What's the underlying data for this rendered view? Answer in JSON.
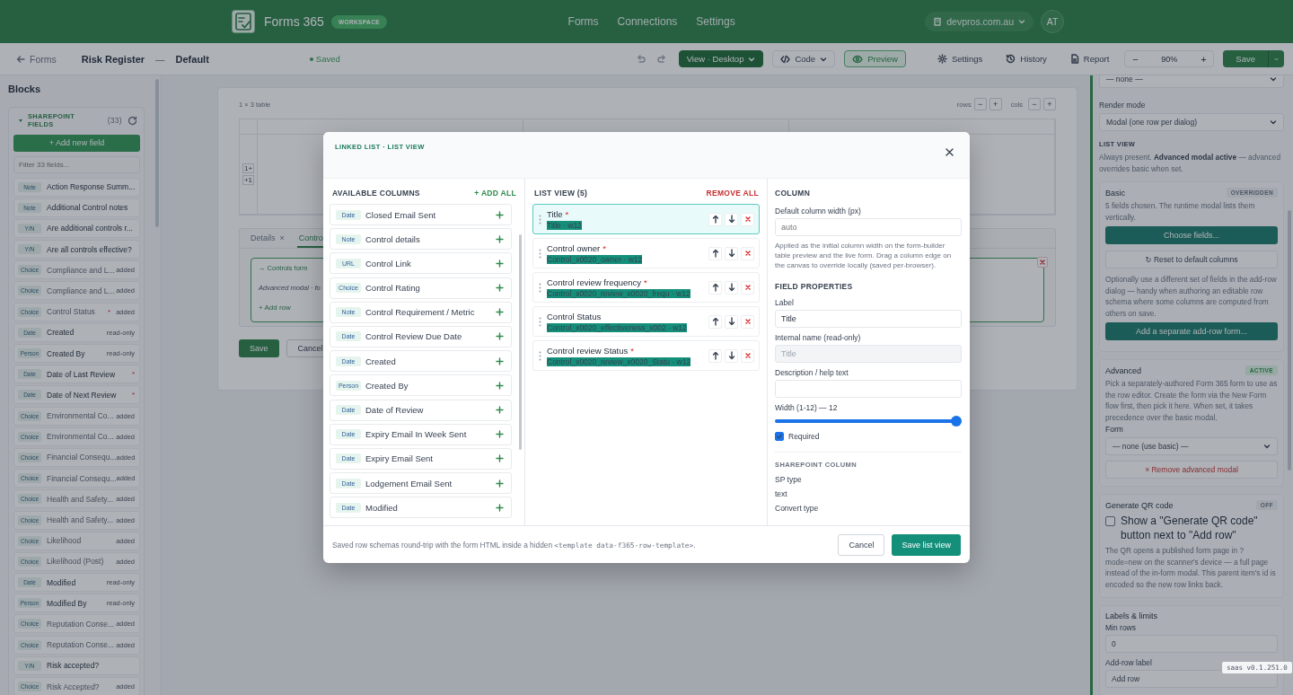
{
  "topbar": {
    "brand": "Forms 365",
    "badge": "WORKSPACE",
    "nav": [
      "Forms",
      "Connections",
      "Settings"
    ],
    "tenant": "devpros.com.au",
    "avatar": "AT"
  },
  "toolbar": {
    "back": "Forms",
    "title": "Risk Register",
    "separator": "—",
    "view_name": "Default",
    "status": "Saved",
    "view_button": "View · Desktop",
    "code_button": "Code",
    "preview_button": "Preview",
    "settings_button": "Settings",
    "history_button": "History",
    "report_button": "Report",
    "zoom_out": "−",
    "zoom": "90%",
    "zoom_in": "+",
    "save_button": "Save"
  },
  "sidebar": {
    "title": "Blocks",
    "section": "SHAREPOINT FIELDS",
    "count": "(33)",
    "add_button": "+ Add new field",
    "filter_placeholder": "Filter 33 fields...",
    "fields": [
      {
        "type": "Note",
        "name": "Action Response Summ...",
        "added": false
      },
      {
        "type": "Note",
        "name": "Additional Control notes",
        "added": false
      },
      {
        "type": "Y/N",
        "name": "Are additional controls r...",
        "added": false
      },
      {
        "type": "Y/N",
        "name": "Are all controls effective?",
        "added": false
      },
      {
        "type": "Choice",
        "name": "Compliance and L...",
        "tag": "added",
        "added": true
      },
      {
        "type": "Choice",
        "name": "Compliance and L...",
        "tag": "added",
        "added": true
      },
      {
        "type": "Choice",
        "name": "Control Status",
        "required_mark": "*",
        "tag": "added",
        "added": true
      },
      {
        "type": "Date",
        "name": "Created",
        "tag": "read-only",
        "added": false
      },
      {
        "type": "Person",
        "name": "Created By",
        "tag": "read-only",
        "added": false
      },
      {
        "type": "Date",
        "name": "Date of Last Review",
        "required_mark": "*",
        "added": false
      },
      {
        "type": "Date",
        "name": "Date of Next Review",
        "required_mark": "*",
        "added": false
      },
      {
        "type": "Choice",
        "name": "Environmental Co...",
        "tag": "added",
        "added": true
      },
      {
        "type": "Choice",
        "name": "Environmental Co...",
        "tag": "added",
        "added": true
      },
      {
        "type": "Choice",
        "name": "Financial Consequ...",
        "tag": "added",
        "added": true
      },
      {
        "type": "Choice",
        "name": "Financial Consequ...",
        "tag": "added",
        "added": true
      },
      {
        "type": "Choice",
        "name": "Health and Safety...",
        "tag": "added",
        "added": true
      },
      {
        "type": "Choice",
        "name": "Health and Safety...",
        "tag": "added",
        "added": true
      },
      {
        "type": "Choice",
        "name": "Likelihood",
        "tag": "added",
        "added": true
      },
      {
        "type": "Choice",
        "name": "Likelihood (Post)",
        "tag": "added",
        "added": true
      },
      {
        "type": "Date",
        "name": "Modified",
        "tag": "read-only",
        "added": false
      },
      {
        "type": "Person",
        "name": "Modified By",
        "tag": "read-only",
        "added": false
      },
      {
        "type": "Choice",
        "name": "Reputation Conse...",
        "tag": "added",
        "added": true
      },
      {
        "type": "Choice",
        "name": "Reputation Conse...",
        "tag": "added",
        "added": true
      },
      {
        "type": "Y/N",
        "name": "Risk accepted?",
        "added": false
      },
      {
        "type": "Choice",
        "name": "Risk Accepted?",
        "tag": "added",
        "added": true
      }
    ]
  },
  "canvas": {
    "table_label": "1 × 3 table",
    "rows_label": "rows",
    "rows_minus": "−",
    "rows_plus": "+",
    "cols_label": "cols",
    "cols_minus": "−",
    "cols_plus": "+",
    "row_handles": [
      "1+",
      "+1"
    ],
    "tabs": [
      {
        "label": "Details",
        "close": "×",
        "selected": false
      },
      {
        "label": "Contro",
        "selected": true
      }
    ],
    "linked_form": "→ Controls form",
    "linked_note": "Advanced modal · fo",
    "add_row": "+ Add row",
    "save_button": "Save",
    "cancel_button": "Cancel"
  },
  "properties": {
    "top_select": "— none —",
    "render_label": "Render mode",
    "render_value": "Modal (one row per dialog)",
    "list_view_heading": "LIST VIEW",
    "list_view_note": "Always present. **Advanced modal active** — advanced overrides basic when set.",
    "basic": {
      "title": "Basic",
      "badge": "OVERRIDDEN",
      "badge_active": false,
      "text": "5 fields chosen. The runtime modal lists them vertically.",
      "choose_button": "Choose fields...",
      "reset_button": "↻ Reset to default columns",
      "add_row_text": "Optionally use a different set of fields in the add-row dialog — handy when authoring an editable row schema where some columns are computed from others on save.",
      "add_row_button": "Add a separate add-row form..."
    },
    "advanced": {
      "title": "Advanced",
      "badge": "ACTIVE",
      "badge_active": true,
      "text": "Pick a separately-authored Form 365 form to use as the row editor. Create the form via the New Form flow first, then pick it here. When set, it takes precedence over the basic modal.",
      "form_label": "Form",
      "form_value": "— none (use basic) —",
      "remove_button": "× Remove advanced modal"
    },
    "qr": {
      "title": "Generate QR code",
      "badge": "OFF",
      "checkbox_label": "Show a \"Generate QR code\" button next to \"Add row\"",
      "checked": false,
      "text": "The QR opens a published form page in ?mode=new on the scanner's device — a full page instead of the in-form modal. This parent item's id is encoded so the new row links back."
    },
    "limits": {
      "title": "Labels & limits",
      "min_label": "Min rows",
      "min_value": "0",
      "add_label": "Add-row label",
      "add_value": "Add row"
    }
  },
  "modal": {
    "eyebrow": "LINKED LIST · LIST VIEW",
    "available": {
      "heading": "AVAILABLE COLUMNS",
      "add_all": "+ ADD ALL",
      "items": [
        {
          "type": "Date",
          "name": "Closed Email Sent"
        },
        {
          "type": "Note",
          "name": "Control details"
        },
        {
          "type": "URL",
          "name": "Control Link"
        },
        {
          "type": "Choice",
          "name": "Control Rating"
        },
        {
          "type": "Note",
          "name": "Control Requirement / Metric"
        },
        {
          "type": "Date",
          "name": "Control Review Due Date"
        },
        {
          "type": "Date",
          "name": "Created"
        },
        {
          "type": "Person",
          "name": "Created By"
        },
        {
          "type": "Date",
          "name": "Date of Review"
        },
        {
          "type": "Date",
          "name": "Expiry Email In Week Sent"
        },
        {
          "type": "Date",
          "name": "Expiry Email Sent"
        },
        {
          "type": "Date",
          "name": "Lodgement Email Sent"
        },
        {
          "type": "Date",
          "name": "Modified"
        }
      ]
    },
    "list_view": {
      "heading": "LIST VIEW (5)",
      "remove_all": "REMOVE ALL",
      "items": [
        {
          "label": "Title",
          "required_mark": "*",
          "internal": "Title · w12",
          "selected": true
        },
        {
          "label": "Control owner",
          "required_mark": "*",
          "internal": "Control_x0020_owner · w12",
          "selected": false
        },
        {
          "label": "Control review frequency",
          "required_mark": "*",
          "internal": "Control_x0020_review_x0020_frequ · w12",
          "selected": false
        },
        {
          "label": "Control Status",
          "internal": "Control_x0020_effectiveness_x002 · w12",
          "selected": false
        },
        {
          "label": "Control review Status",
          "required_mark": "*",
          "internal": "Control_x0020_review_x0020_Statu · w12",
          "selected": false
        }
      ]
    },
    "column": {
      "heading": "COLUMN",
      "width_label": "Default column width (px)",
      "width_placeholder": "auto",
      "width_help": "Applied as the initial column width on the form-builder table preview and the live form. Drag a column edge on the canvas to override locally (saved per-browser).",
      "props_heading": "FIELD PROPERTIES",
      "label_label": "Label",
      "label_value": "Title",
      "internal_label": "Internal name (read-only)",
      "internal_value": "Title",
      "desc_label": "Description / help text",
      "slider_label": "Width (1-12) — 12",
      "level": 1,
      "required_label": "Required",
      "required_checked": true,
      "sp_heading": "SHAREPOINT COLUMN",
      "sp_type_label": "SP type",
      "sp_type": "text",
      "convert_label": "Convert type"
    },
    "footer": {
      "note": "Saved row schemas round-trip with the form HTML inside a hidden ",
      "note_code": "<template data-f365-row-template>",
      "note_end": ".",
      "cancel": "Cancel",
      "save": "Save list view"
    }
  },
  "version": "saas v0.1.251.0"
}
